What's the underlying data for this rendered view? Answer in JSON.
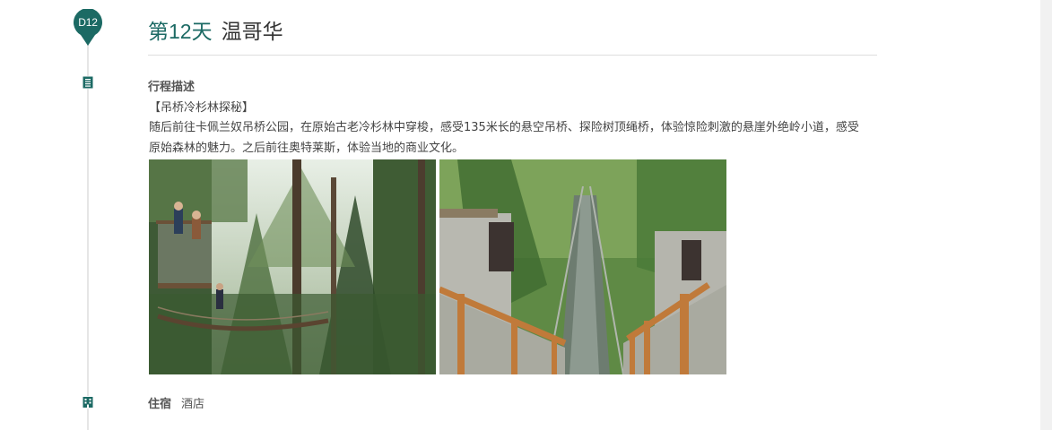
{
  "day": {
    "badge": "D12",
    "number_label": "第12天",
    "city": "温哥华"
  },
  "itinerary": {
    "section_title": "行程描述",
    "highlight": "【吊桥冷杉林探秘】",
    "description": "随后前往卡佩兰奴吊桥公园，在原始古老冷杉林中穿梭，感受135米长的悬空吊桥、探险树顶绳桥，体验惊险刺激的悬崖外绝岭小道，感受原始森林的魅力。之后前往奥特莱斯，体验当地的商业文化。"
  },
  "accommodation": {
    "label": "住宿",
    "value": "酒店"
  },
  "colors": {
    "accent": "#1c6a64",
    "timeline_line": "#e6e6e6",
    "divider": "#dedede"
  },
  "icons": {
    "day_marker": "map-pin-icon",
    "itinerary": "document-list-icon",
    "accommodation": "building-icon"
  }
}
